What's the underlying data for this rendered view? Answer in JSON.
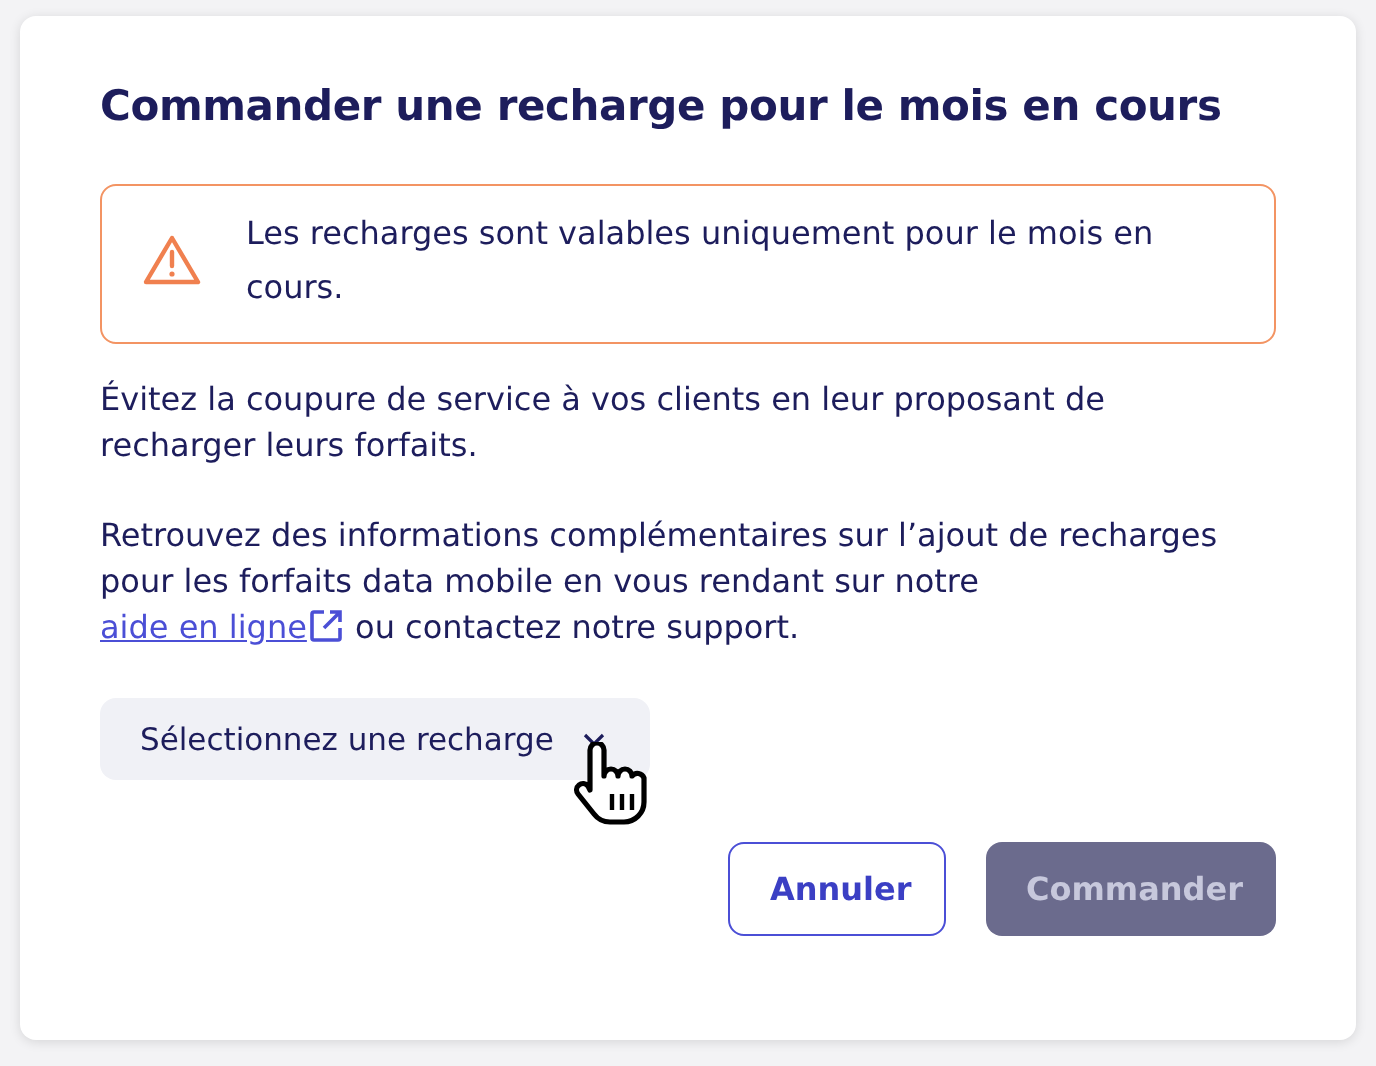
{
  "dialog": {
    "title": "Commander une recharge pour le mois en cours",
    "alert": {
      "kind": "warning",
      "text": "Les recharges sont valables uniquement pour le mois en cours."
    },
    "paragraphs": [
      {
        "text": "Évitez la coupure de service à vos clients en leur proposant de recharger leurs forfaits."
      },
      {
        "text": "Retrouvez des informations complémentaires sur l’ajout de recharges pour les forfaits data mobile en vous rendant sur notre ",
        "link": "aide en ligne",
        "after": " ou contactez notre support."
      }
    ],
    "select": {
      "placeholder": "Sélectionnez une recharge"
    },
    "buttons": [
      {
        "label": "Annuler",
        "kind": "secondary",
        "disabled": false
      },
      {
        "label": "Commander",
        "kind": "primary",
        "disabled": true
      }
    ]
  }
}
